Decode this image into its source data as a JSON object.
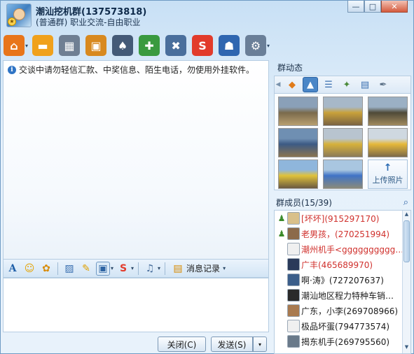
{
  "window": {
    "group_name": "潮汕挖机群(137573818)",
    "group_sub": "(普通群) 职业交流-自由职业",
    "controls": [
      "—",
      "□",
      "✕"
    ]
  },
  "toolbar": {
    "items": [
      {
        "name": "home-icon",
        "glyph": "⌂",
        "color": "#e8751a",
        "caret": "▾"
      },
      {
        "name": "folder-icon",
        "glyph": "▬",
        "color": "#f0a11c",
        "caret": ""
      },
      {
        "name": "film-icon",
        "glyph": "▦",
        "color": "#6f7f93",
        "caret": ""
      },
      {
        "name": "board-icon",
        "glyph": "▣",
        "color": "#d8891f",
        "caret": ""
      },
      {
        "name": "card-icon",
        "glyph": "♠",
        "color": "#445a77",
        "caret": ""
      },
      {
        "name": "note-add-icon",
        "glyph": "✚",
        "color": "#3a9a3f",
        "caret": ""
      },
      {
        "name": "tools-icon",
        "glyph": "✖",
        "color": "#4a6f9c",
        "caret": ""
      },
      {
        "name": "soso-icon",
        "glyph": "S",
        "color": "#e23b2b",
        "caret": ""
      },
      {
        "name": "admin-icon",
        "glyph": "☗",
        "color": "#2f66b0",
        "caret": ""
      },
      {
        "name": "settings-icon",
        "glyph": "⚙",
        "color": "#6a7f98",
        "caret": "▾"
      }
    ]
  },
  "chat": {
    "notice": "交谈中请勿轻信汇款、中奖信息、陌生电话，勿使用外挂软件。"
  },
  "format_bar": {
    "history_label": "消息记录"
  },
  "buttons": {
    "close_label": "关闭(C)",
    "send_label": "发送(S)",
    "send_arrow": "▾"
  },
  "right": {
    "feed_title": "群动态",
    "upload_label": "上传照片",
    "members_title": "群成员(15/39)",
    "photos": [
      {
        "name": "photo-1",
        "colors": [
          "#8aa0b8",
          "#7a6a4c",
          "#b8a070"
        ]
      },
      {
        "name": "photo-2",
        "colors": [
          "#a7b8c8",
          "#c9a13a",
          "#7a6342"
        ]
      },
      {
        "name": "photo-3",
        "colors": [
          "#9bb0c4",
          "#4f4a38",
          "#a08a5e"
        ]
      },
      {
        "name": "photo-4",
        "colors": [
          "#6f8fb2",
          "#3c5a84",
          "#8a7450"
        ]
      },
      {
        "name": "photo-5",
        "colors": [
          "#b8c4cf",
          "#d6b13a",
          "#8c7a58"
        ]
      },
      {
        "name": "photo-6",
        "colors": [
          "#cfd8e0",
          "#e6b83a",
          "#7b6a4a"
        ]
      },
      {
        "name": "photo-7",
        "colors": [
          "#8fb6dc",
          "#e0c23a",
          "#6a5a40"
        ]
      },
      {
        "name": "photo-8",
        "colors": [
          "#a9c6e0",
          "#3f73c6",
          "#8a8a7a"
        ]
      }
    ],
    "members": [
      {
        "role": "👤",
        "avatar": "#d9c08a",
        "name": "[坏坏](915297170)",
        "color": "red"
      },
      {
        "role": "👤",
        "avatar": "#8c6a4a",
        "name": "老男孩，(270251994)",
        "color": "red"
      },
      {
        "role": "",
        "avatar": "#f0f0f0",
        "name": "潮州机手<gggggggggggg…",
        "color": "red"
      },
      {
        "role": "",
        "avatar": "#2a3a5a",
        "name": "广丰(465689970)",
        "color": "red"
      },
      {
        "role": "",
        "avatar": "#3b5e8a",
        "name": "啊·涛》(727207637)",
        "color": "dark"
      },
      {
        "role": "",
        "avatar": "#2a2a2a",
        "name": "潮汕地区程力特种车销…",
        "color": "dark"
      },
      {
        "role": "",
        "avatar": "#a87a50",
        "name": "广东，小李(269708966)",
        "color": "dark"
      },
      {
        "role": "",
        "avatar": "#f0f0f0",
        "name": "极品坏蛋(794773574)",
        "color": "dark"
      },
      {
        "role": "",
        "avatar": "#6a7a8a",
        "name": "揭东机手(269795560)",
        "color": "dark"
      }
    ]
  }
}
